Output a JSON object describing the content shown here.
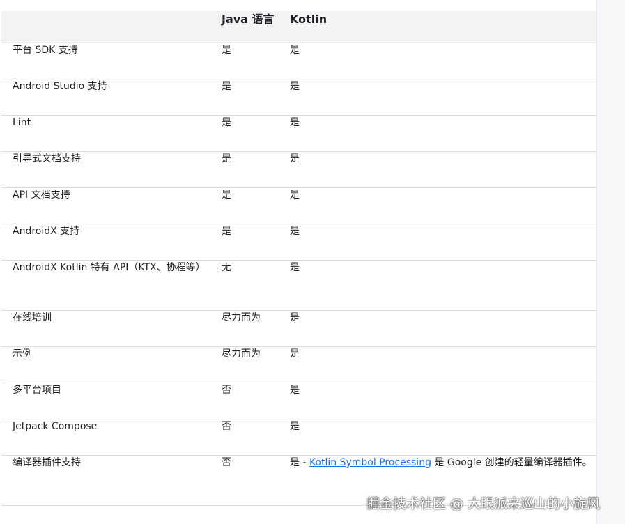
{
  "table": {
    "headers": [
      "",
      "Java 语言",
      "Kotlin"
    ],
    "rows": [
      [
        "平台 SDK 支持",
        "是",
        "是"
      ],
      [
        "Android Studio 支持",
        "是",
        "是"
      ],
      [
        "Lint",
        "是",
        "是"
      ],
      [
        "引导式文档支持",
        "是",
        "是"
      ],
      [
        "API 文档支持",
        "是",
        "是"
      ],
      [
        "AndroidX 支持",
        "是",
        "是"
      ],
      [
        "AndroidX Kotlin 特有 API（KTX、协程等）",
        "无",
        "是"
      ],
      [
        "在线培训",
        "尽力而为",
        "是"
      ],
      [
        "示例",
        "尽力而为",
        "是"
      ],
      [
        "多平台项目",
        "否",
        "是"
      ],
      [
        "Jetpack Compose",
        "否",
        "是"
      ],
      [
        "编译器插件支持",
        "否",
        ""
      ]
    ],
    "last_kotlin": {
      "prefix": "是 - ",
      "link": "Kotlin Symbol Processing",
      "suffix": " 是 Google 创建的轻量编译器插件。"
    }
  },
  "watermark": "掘金技术社区 @ 大眼派来巡山的小旋风"
}
